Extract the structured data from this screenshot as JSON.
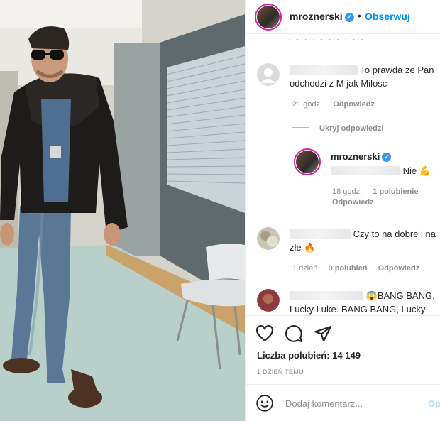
{
  "header": {
    "username": "mroznerski",
    "dot": "•",
    "follow_label": "Obserwuj",
    "verified_icon": "verified-badge-icon"
  },
  "comments": [
    {
      "text": "To prawda ze Pan odchodzi z M jak Milosc",
      "time": "21 godz.",
      "reply_label": "Odpowiedz"
    },
    {
      "hide_replies_label": "Ukryj odpowiedzi"
    },
    {
      "username": "mroznerski",
      "text": "Nie",
      "emoji": "💪",
      "time": "18 godz.",
      "likes": "1 polubienie",
      "reply_label": "Odpowiedz"
    },
    {
      "text": "Czy to na dobre i na złe",
      "emoji": "🔥",
      "time": "1 dzień",
      "likes": "9 polubień",
      "reply_label": "Odpowiedz"
    },
    {
      "emoji": "😱",
      "text": "BANG BANG, Lucky Luke. BANG BANG, Lucky"
    }
  ],
  "actions": {
    "like_icon": "heart-icon",
    "comment_icon": "comment-icon",
    "share_icon": "send-icon"
  },
  "likes_text": "Liczba polubień: 14 149",
  "date_text": "1 DZIEŃ TEMU",
  "add_comment": {
    "placeholder": "Dodaj komentarz...",
    "post_label": "Opublikuj",
    "emoji_icon": "smiley-icon"
  },
  "colors": {
    "accent": "#0095f6",
    "text": "#262626",
    "muted": "#8e8e8e"
  }
}
